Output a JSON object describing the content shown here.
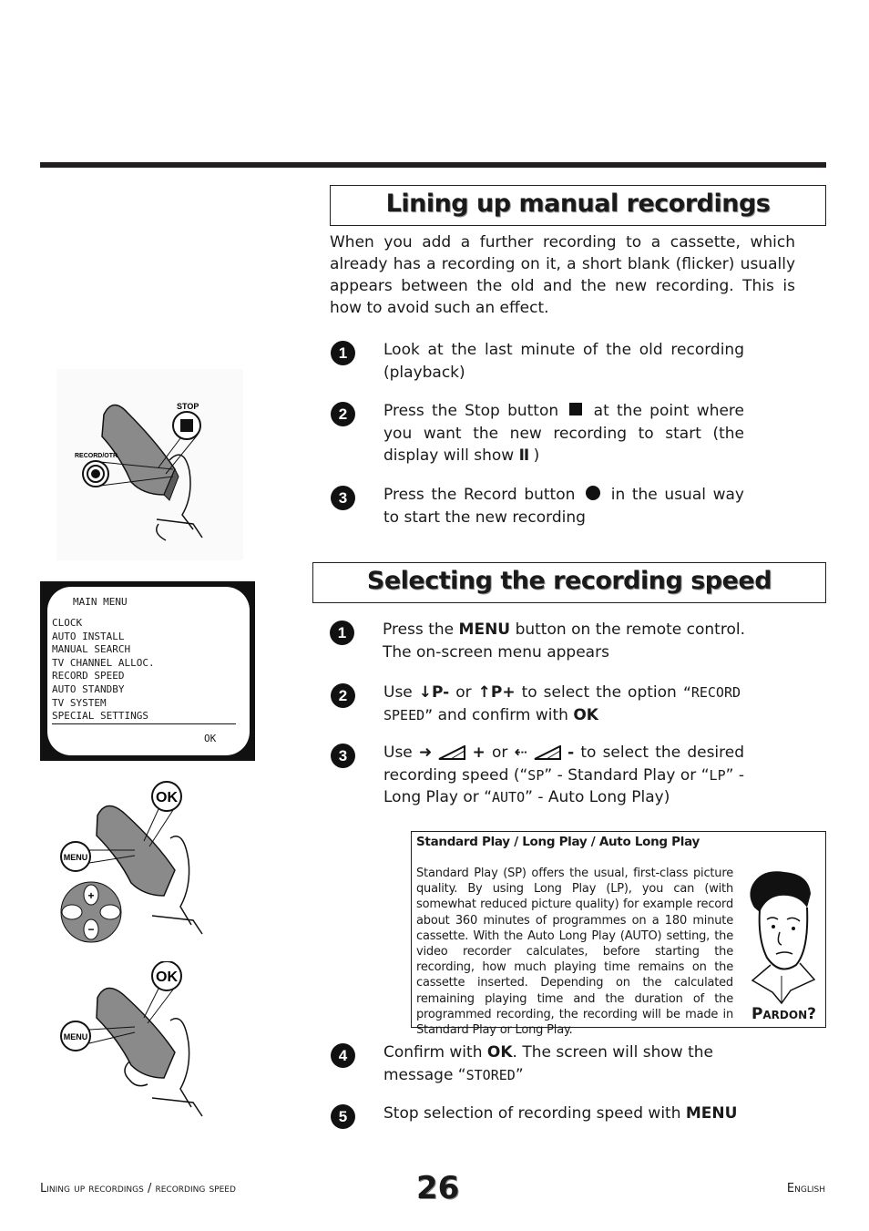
{
  "section1": {
    "title": "Lining up manual recordings",
    "intro": "When you add a further recording to a cassette, which already has a recording on it, a short blank (flicker) usually appears between the old and the new recording. This is how to avoid such an effect.",
    "steps": [
      {
        "num": "1",
        "text": "Look at the last minute of the old recording (playback)"
      },
      {
        "num": "2",
        "text_a": "Press the Stop button",
        "text_b": "at the point where you want the new recording to start (the display will show",
        "text_c": ")",
        "pause_glyph": "II",
        "icon": "stop-square-icon"
      },
      {
        "num": "3",
        "text_a": "Press the Record button",
        "text_b": "in the usual way to start the new recording",
        "icon": "record-dot-icon"
      }
    ]
  },
  "section2": {
    "title": "Selecting the recording speed",
    "steps": [
      {
        "num": "1",
        "text_a": "Press the",
        "key": "MENU",
        "text_b": "button on the remote control. The on-screen menu appears"
      },
      {
        "num": "2",
        "text_a": "Use",
        "key1": "P-",
        "text_or": "or",
        "key2": "P+",
        "text_b": "to select the option",
        "option": "“RECORD SPEED”",
        "text_c": "and confirm with",
        "key3": "OK"
      },
      {
        "num": "3",
        "text_a": "Use",
        "key1": "+",
        "text_or": "or",
        "key2": "-",
        "text_b": "to select the desired recording speed (“",
        "sp": "SP",
        "text_c": "” - Standard Play or “",
        "lp": "LP",
        "text_d": "” - Long Play or “",
        "auto": "AUTO",
        "text_e": "” - Auto Long Play)"
      },
      {
        "num": "4",
        "text_a": "Confirm with",
        "key": "OK",
        "text_b": ". The screen will show the message “",
        "msg": "STORED",
        "text_c": "”"
      },
      {
        "num": "5",
        "text_a": "Stop selection of recording speed with",
        "key": "MENU"
      }
    ],
    "infobox": {
      "heading": "Standard Play /  Long Play  /  Auto Long Play",
      "body": "Standard Play (SP) offers the usual, first-class picture quality. By using Long Play (LP), you can (with somewhat reduced picture quality) for example record about 360 minutes of programmes on a 180 minute cassette. With the Auto Long Play (AUTO) setting, the video recorder calculates, before starting the recording, how much playing time remains on the cassette inserted. Depending on the calculated remaining playing time and the duration of the programmed recording, the recording will be made in Standard Play or Long Play.",
      "pardon": "Pardon?"
    }
  },
  "tv_menu": {
    "title": "MAIN MENU",
    "items": [
      "CLOCK",
      "AUTO INSTALL",
      "MANUAL SEARCH",
      "TV CHANNEL ALLOC.",
      "RECORD SPEED",
      "AUTO STANDBY",
      "TV SYSTEM",
      "SPECIAL SETTINGS"
    ],
    "ok": "OK"
  },
  "illustrations": {
    "remote1": {
      "stop_label": "STOP",
      "record_label": "RECORD/OTR"
    },
    "remote2": {
      "ok_label": "OK",
      "menu_label": "MENU"
    },
    "remote3": {
      "ok_label": "OK",
      "menu_label": "MENU"
    }
  },
  "footer": {
    "left": "Lining up recordings / recording speed",
    "page": "26",
    "right": "English"
  }
}
